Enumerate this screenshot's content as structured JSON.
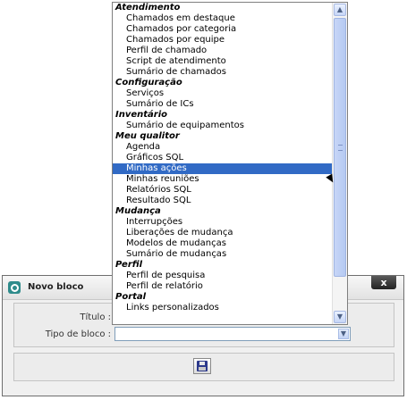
{
  "dialog": {
    "title": "Novo bloco",
    "close_label": "x",
    "form": {
      "titulo_label": "Título :",
      "tipo_label": "Tipo de bloco :",
      "tipo_value": ""
    },
    "save_icon": "floppy-disk-icon"
  },
  "dropdown": {
    "groups": [
      {
        "label": "Atendimento",
        "options": [
          "Chamados em destaque",
          "Chamados por categoria",
          "Chamados por equipe",
          "Perfil de chamado",
          "Script de atendimento",
          "Sumário de chamados"
        ]
      },
      {
        "label": "Configuração",
        "options": [
          "Serviços",
          "Sumário de ICs"
        ]
      },
      {
        "label": "Inventário",
        "options": [
          "Sumário de equipamentos"
        ]
      },
      {
        "label": "Meu qualitor",
        "options": [
          "Agenda",
          "Gráficos SQL",
          "Minhas ações",
          "Minhas reuniões",
          "Relatórios SQL",
          "Resultado SQL"
        ]
      },
      {
        "label": "Mudança",
        "options": [
          "Interrupções",
          "Liberações de mudança",
          "Modelos de mudanças",
          "Sumário de mudanças"
        ]
      },
      {
        "label": "Perfil",
        "options": [
          "Perfil de pesquisa",
          "Perfil de relatório"
        ]
      },
      {
        "label": "Portal",
        "options": [
          "Links personalizados"
        ]
      }
    ],
    "selected": "Minhas ações"
  },
  "colors": {
    "selection": "#316ac5",
    "dialog_bg": "#f0f0f0",
    "close_button": "#222222"
  }
}
